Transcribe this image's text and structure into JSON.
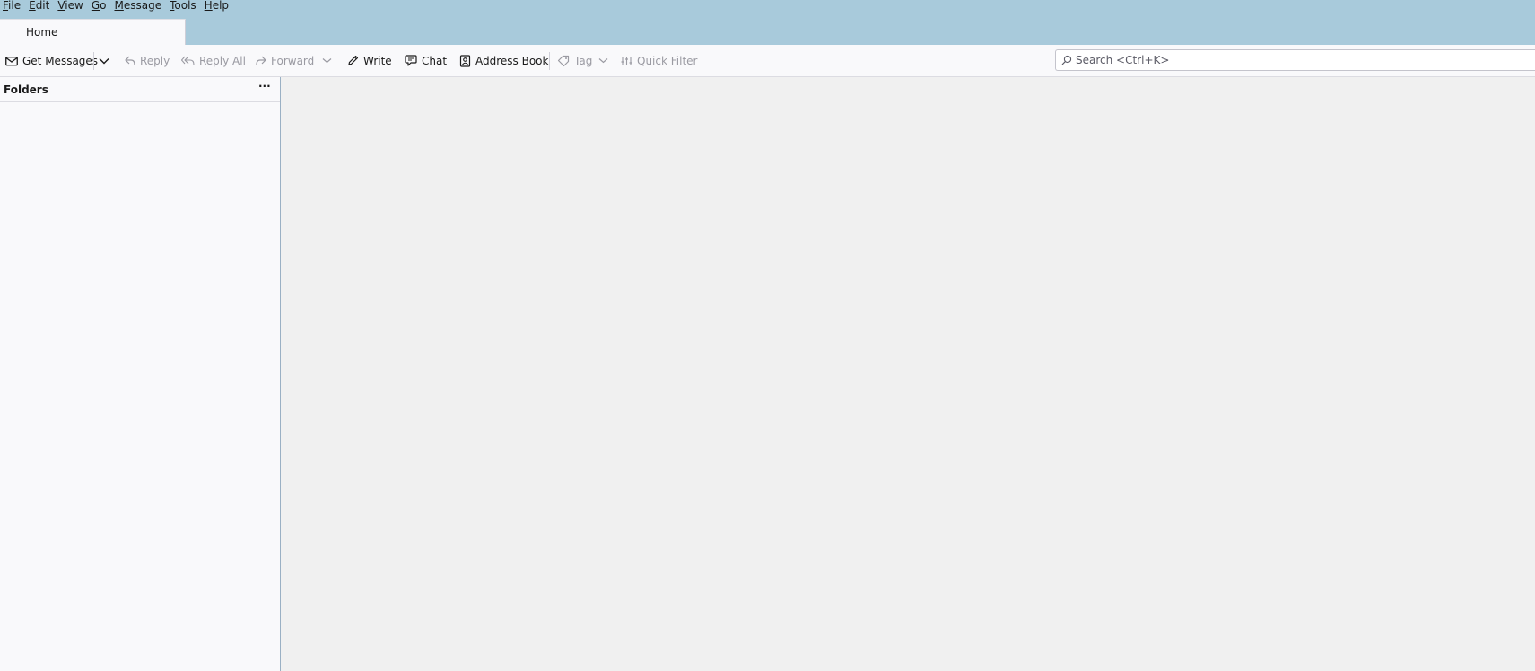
{
  "menubar": {
    "items": [
      {
        "label_ul": "F",
        "label_rest": "ile"
      },
      {
        "label_ul": "E",
        "label_rest": "dit"
      },
      {
        "label_ul": "V",
        "label_rest": "iew"
      },
      {
        "label_ul": "G",
        "label_rest": "o"
      },
      {
        "label_ul": "M",
        "label_rest": "essage"
      },
      {
        "label_ul": "T",
        "label_rest": "ools"
      },
      {
        "label_ul": "H",
        "label_rest": "elp"
      }
    ]
  },
  "tab": {
    "label": "Home"
  },
  "toolbar": {
    "get_messages": "Get Messages",
    "reply": "Reply",
    "reply_all": "Reply All",
    "forward": "Forward",
    "write": "Write",
    "chat": "Chat",
    "address_book": "Address Book",
    "tag": "Tag",
    "quick_filter": "Quick Filter"
  },
  "search": {
    "placeholder": "Search <Ctrl+K>"
  },
  "folders": {
    "title": "Folders",
    "more": "···"
  },
  "icons": {
    "get_messages": "envelope-icon",
    "reply": "reply-icon",
    "reply_all": "reply-all-icon",
    "forward": "forward-icon",
    "write": "pencil-icon",
    "chat": "chat-bubble-icon",
    "address_book": "address-book-icon",
    "tag": "tag-icon",
    "quick_filter": "filter-sliders-icon",
    "search": "search-icon"
  },
  "colors": {
    "titlebar": "#a8cadb",
    "toolbar": "#f9f9fb",
    "main_background": "#f0f0f0",
    "disabled_text": "#9a9aa2"
  }
}
